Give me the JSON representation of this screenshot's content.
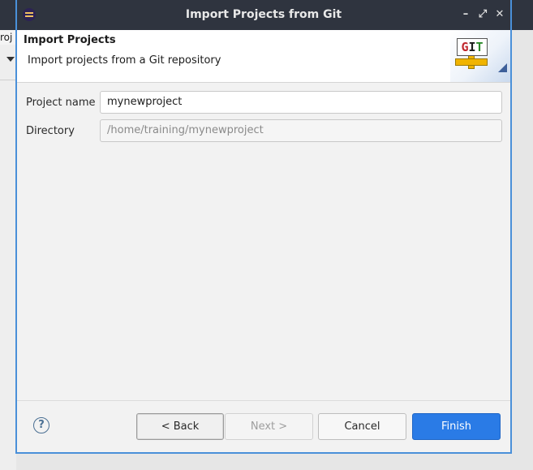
{
  "background": {
    "truncated_text": "roj"
  },
  "dialog": {
    "title": "Import Projects from Git",
    "window_controls": {
      "minimize": "–",
      "restore": "⤢",
      "close": "✕"
    },
    "header": {
      "title": "Import Projects",
      "description": "Import projects from a Git repository",
      "logo_text": {
        "g": "G",
        "i": "I",
        "t": "T"
      }
    },
    "form": {
      "project_name": {
        "label": "Project name",
        "value": "mynewproject"
      },
      "directory": {
        "label": "Directory",
        "value": "/home/training/mynewproject"
      }
    },
    "footer": {
      "help_symbol": "?",
      "back_label": "< Back",
      "next_label": "Next >",
      "cancel_label": "Cancel",
      "finish_label": "Finish"
    }
  },
  "colors": {
    "titlebar": "#2f343f",
    "accent": "#2a7be6",
    "dialog_border": "#4a90d9"
  }
}
